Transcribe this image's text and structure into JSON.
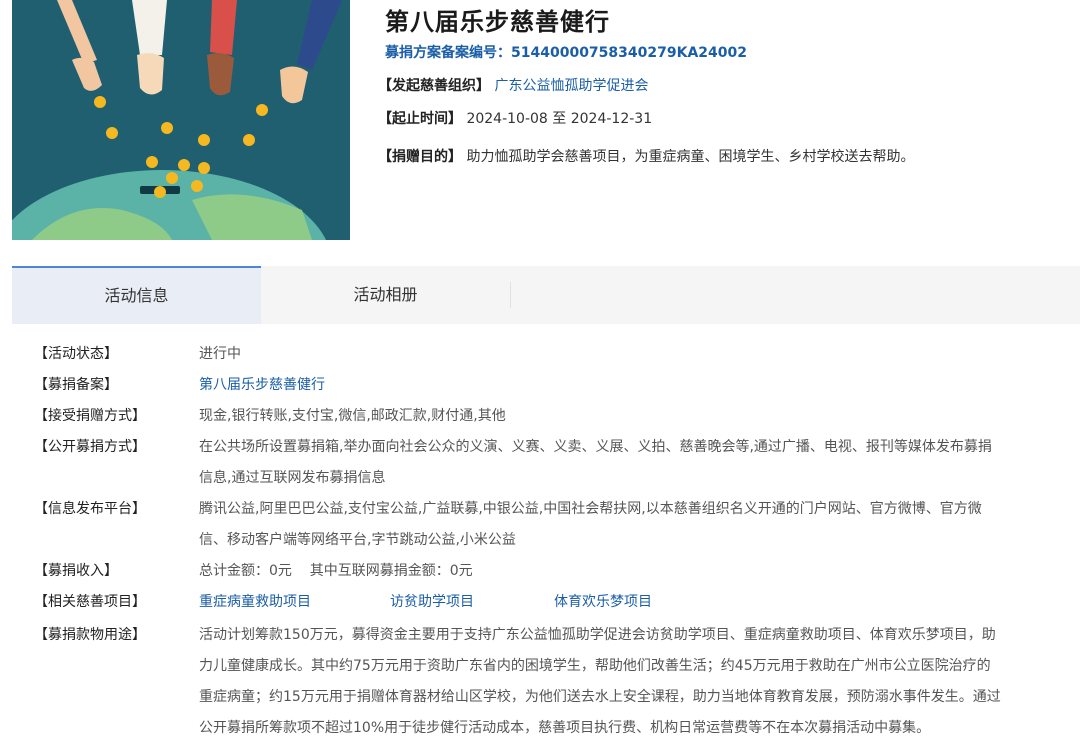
{
  "header": {
    "title": "第八届乐步慈善健行",
    "registration_label": "募捐方案备案编号：",
    "registration_number": "51440000758340279KA24002",
    "org_label": "【发起慈善组织】",
    "org_name": "广东公益恤孤助学促进会",
    "time_label": "【起止时间】",
    "start_date": "2024-10-08",
    "date_sep": "至",
    "end_date": "2024-12-31",
    "purpose_label": "【捐赠目的】",
    "purpose_text": "助力恤孤助学会慈善项目，为重症病童、困境学生、乡村学校送去帮助。"
  },
  "tabs": [
    {
      "label": "活动信息",
      "active": true
    },
    {
      "label": "活动相册",
      "active": false
    }
  ],
  "details": {
    "status": {
      "label": "【活动状态】",
      "value": "进行中"
    },
    "filing": {
      "label": "【募捐备案】",
      "value": "第八届乐步慈善健行"
    },
    "accept_methods": {
      "label": "【接受捐赠方式】",
      "value": "现金,银行转账,支付宝,微信,邮政汇款,财付通,其他"
    },
    "public_methods": {
      "label": "【公开募捐方式】",
      "line1": "在公共场所设置募捐箱,举办面向社会公众的义演、义赛、义卖、义展、义拍、慈善晚会等,通过广播、电视、报刊等媒体发布募捐",
      "line2": "信息,通过互联网发布募捐信息"
    },
    "platforms": {
      "label": "【信息发布平台】",
      "line1": "腾讯公益,阿里巴巴公益,支付宝公益,广益联募,中银公益,中国社会帮扶网,以本慈善组织名义开通的门户网站、官方微博、官方微",
      "line2": "信、移动客户端等网络平台,字节跳动公益,小米公益"
    },
    "income": {
      "label": "【募捐收入】",
      "value": "总计金额：0元    其中互联网募捐金额：0元"
    },
    "related": {
      "label": "【相关慈善项目】",
      "projects": [
        "重症病童救助项目",
        "访贫助学项目",
        "体育欢乐梦项目"
      ]
    },
    "usage": {
      "label": "【募捐款物用途】",
      "line1": "活动计划筹款150万元，募得资金主要用于支持广东公益恤孤助学促进会访贫助学项目、重症病童救助项目、体育欢乐梦项目，助",
      "line2": "力儿童健康成长。其中约75万元用于资助广东省内的困境学生，帮助他们改善生活；约45万元用于救助在广州市公立医院治疗的",
      "line3": "重症病童；约15万元用于捐赠体育器材给山区学校，为他们送去水上安全课程，助力当地体育教育发展，预防溺水事件发生。通过",
      "line4": "公开募捐所筹款项不超过10%用于徒步健行活动成本，慈善项目执行费、机构日常运营费等不在本次募捐活动中募集。"
    }
  },
  "colors": {
    "link": "#1b5ea8",
    "tab_active_bg": "#e9eef6",
    "tab_accent": "#4c86d4",
    "tabs_bg": "#f5f5f5"
  }
}
